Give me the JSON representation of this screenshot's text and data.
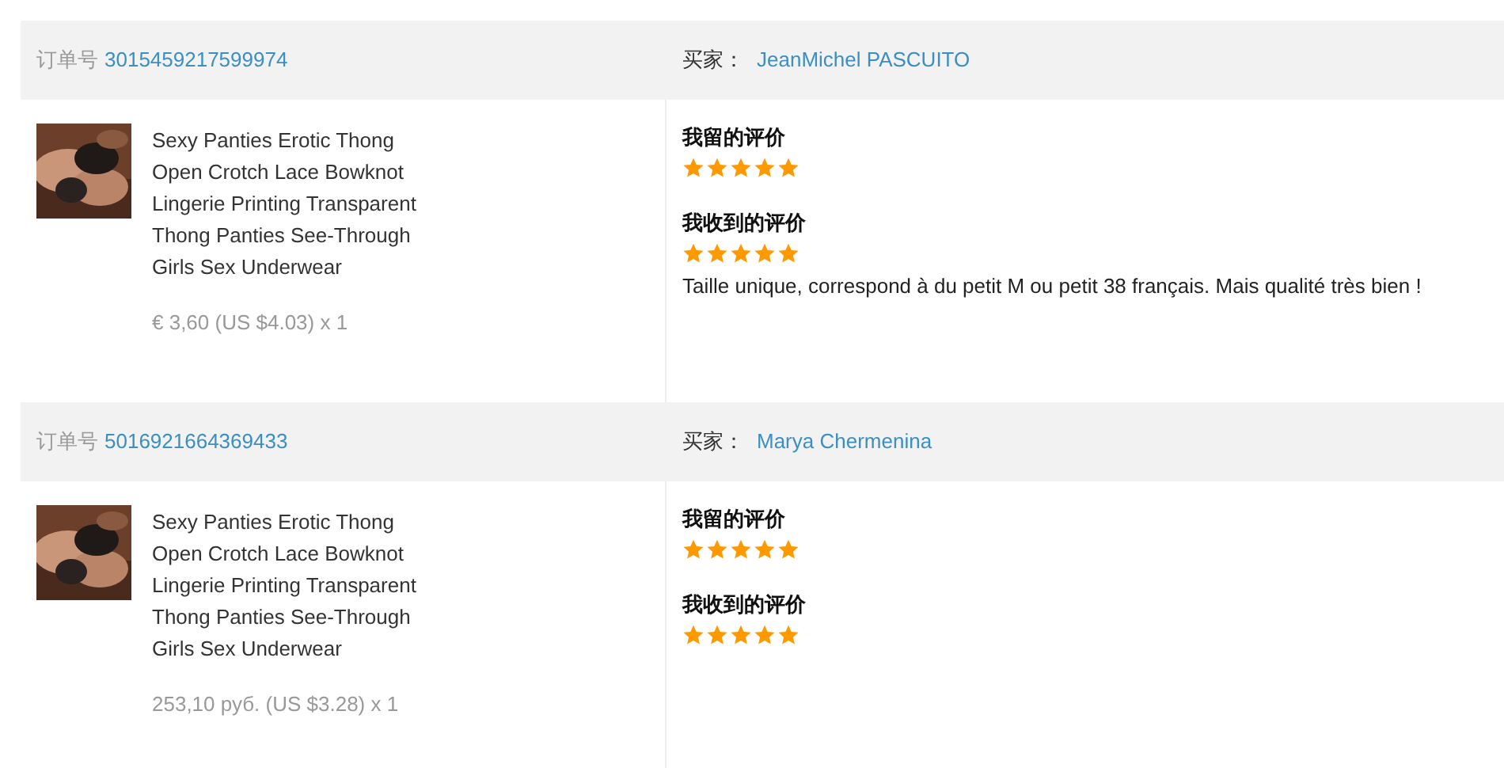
{
  "orders": [
    {
      "order_label": "订单号",
      "order_number": "3015459217599974",
      "buyer_label": "买家：",
      "buyer_name": "JeanMichel PASCUITO",
      "product": {
        "title": "Sexy Panties Erotic Thong Open Crotch Lace Bowknot Lingerie Printing Transparent Thong Panties See-Through Girls Sex Underwear",
        "price": "€ 3,60 (US $4.03) x 1"
      },
      "given_feedback": {
        "label": "我留的评价",
        "stars": 5
      },
      "received_feedback": {
        "label": "我收到的评价",
        "stars": 5,
        "comment": "Taille unique, correspond à du petit M ou petit 38 français. Mais qualité très bien !"
      }
    },
    {
      "order_label": "订单号",
      "order_number": "5016921664369433",
      "buyer_label": "买家：",
      "buyer_name": "Marya Chermenina",
      "product": {
        "title": "Sexy Panties Erotic Thong Open Crotch Lace Bowknot Lingerie Printing Transparent Thong Panties See-Through Girls Sex Underwear",
        "price": "253,10 руб. (US $3.28) x 1"
      },
      "given_feedback": {
        "label": "我留的评价",
        "stars": 5
      },
      "received_feedback": {
        "label": "我收到的评价",
        "stars": 5
      }
    }
  ]
}
